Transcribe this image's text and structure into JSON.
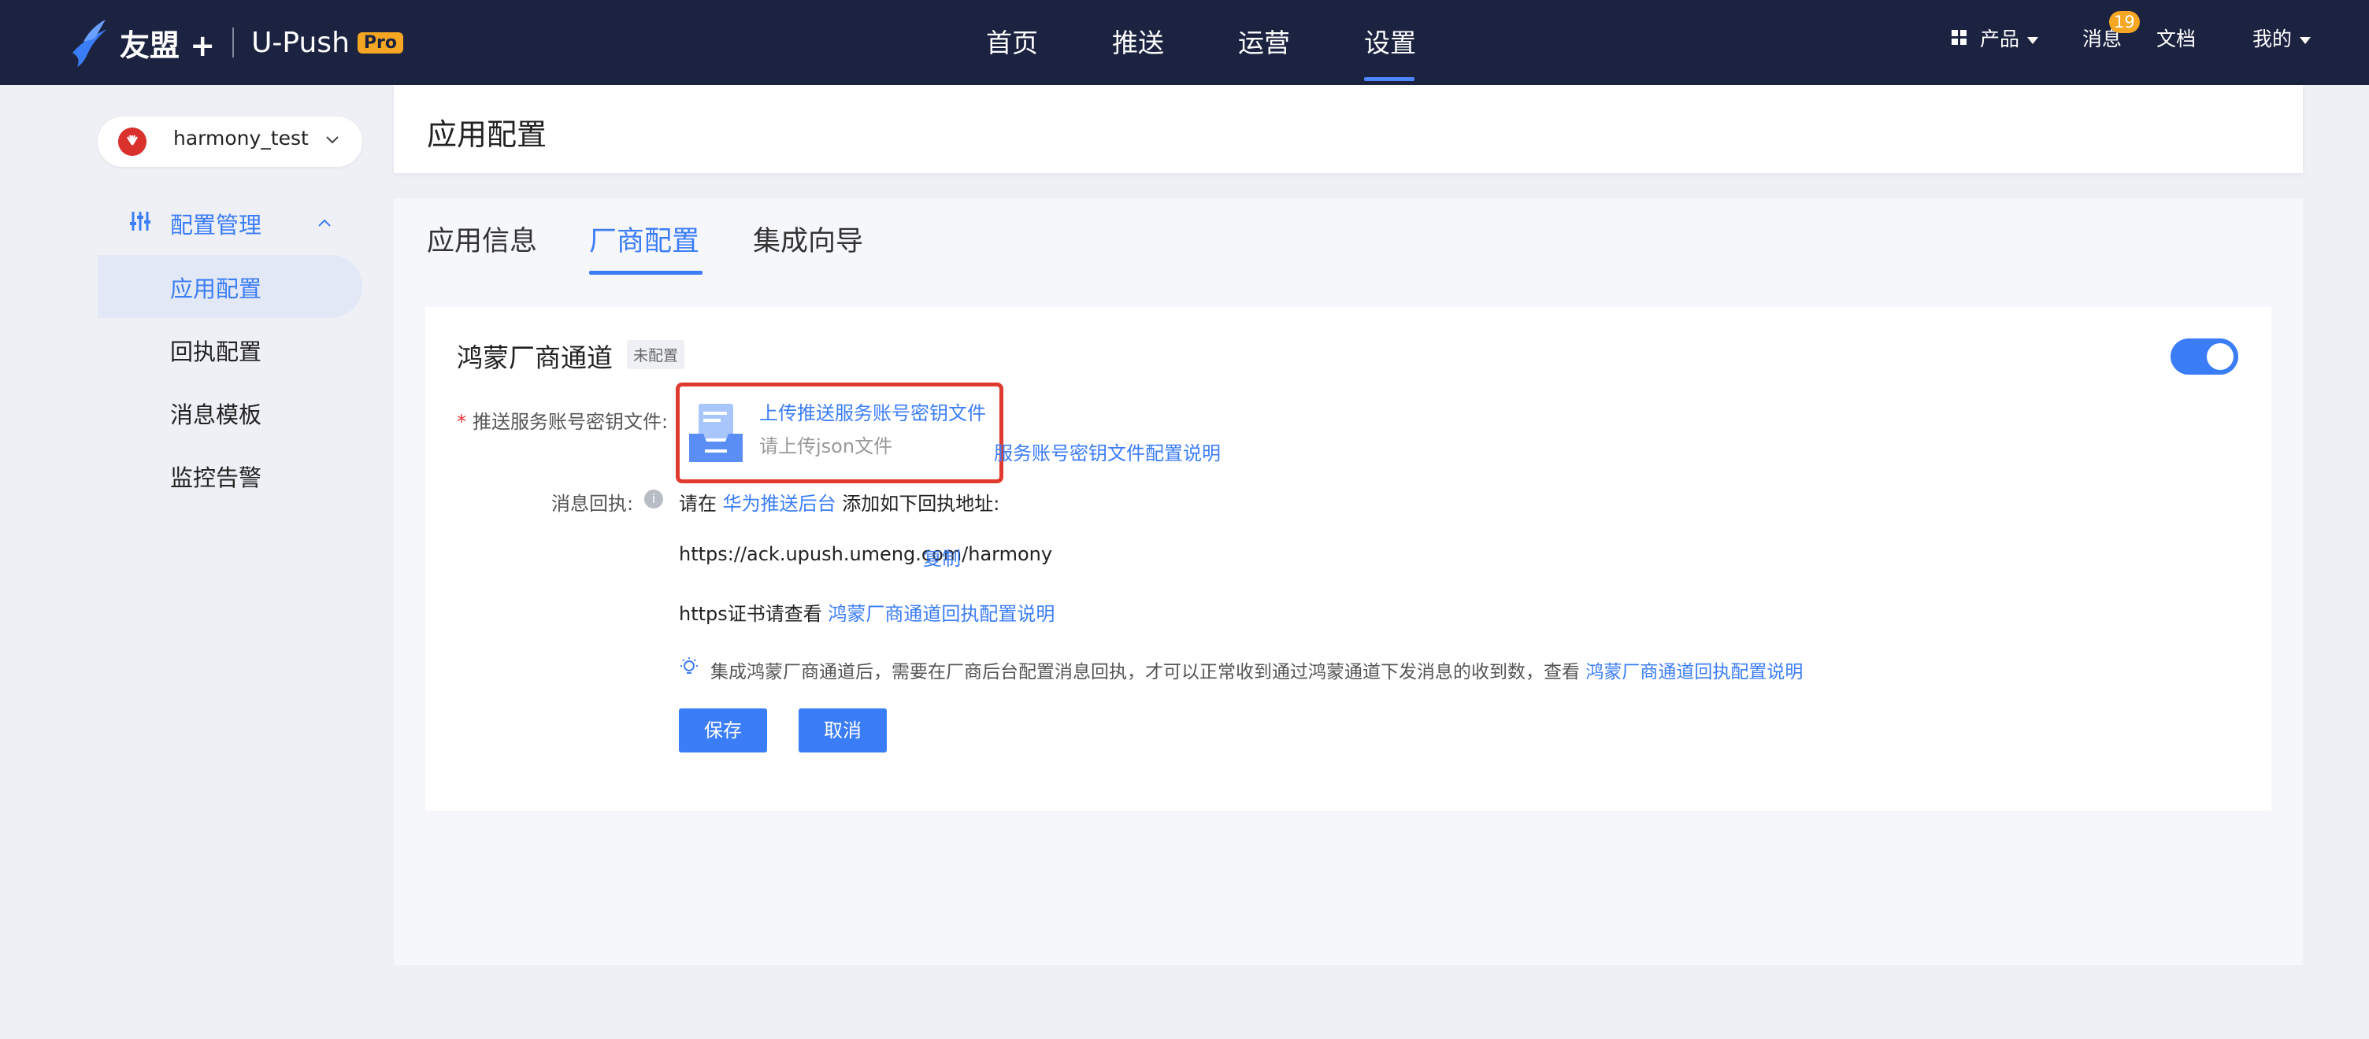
{
  "header": {
    "brand": "友盟 +",
    "product": "U-Push",
    "pro_badge": "Pro",
    "nav": [
      "首页",
      "推送",
      "运营",
      "设置"
    ],
    "active_nav": "设置",
    "products_label": "产品",
    "messages_label": "消息",
    "messages_count": "19",
    "docs_label": "文档",
    "me_label": "我的"
  },
  "sidebar": {
    "app_name": "harmony_test",
    "group_label": "配置管理",
    "items": [
      {
        "label": "应用配置",
        "active": true
      },
      {
        "label": "回执配置",
        "active": false
      },
      {
        "label": "消息模板",
        "active": false
      },
      {
        "label": "监控告警",
        "active": false
      }
    ]
  },
  "page": {
    "title": "应用配置",
    "tabs": [
      {
        "label": "应用信息",
        "active": false
      },
      {
        "label": "厂商配置",
        "active": true
      },
      {
        "label": "集成向导",
        "active": false
      }
    ]
  },
  "channel": {
    "title": "鸿蒙厂商通道",
    "status_tag": "未配置",
    "enabled": true,
    "key_file_label": "推送服务账号密钥文件:",
    "upload_link": "上传推送服务账号密钥文件",
    "upload_hint": "请上传json文件",
    "key_doc_link": "服务账号密钥文件配置说明",
    "receipt_label": "消息回执:",
    "receipt_prefix": "请在",
    "receipt_console_link": "华为推送后台",
    "receipt_suffix": "添加如下回执地址:",
    "receipt_url": "https://ack.upush.umeng.com/harmony",
    "copy_label": "复制",
    "https_prefix": "https证书请查看",
    "https_doc_link": "鸿蒙厂商通道回执配置说明",
    "tip_text": "集成鸿蒙厂商通道后，需要在厂商后台配置消息回执，才可以正常收到通过鸿蒙通道下发消息的收到数，查看",
    "tip_link": "鸿蒙厂商通道回执配置说明",
    "save_label": "保存",
    "cancel_label": "取消"
  },
  "colors": {
    "topbar": "#1c2340",
    "accent": "#3b7df7",
    "badge": "#f5a623",
    "highlight_box": "#e03a2f",
    "background": "#eef0f5"
  }
}
